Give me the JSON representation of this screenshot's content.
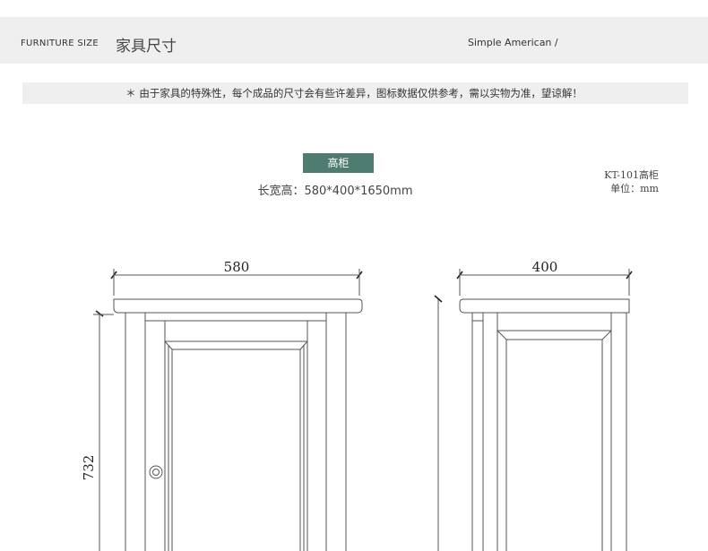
{
  "header": {
    "label_en": "FURNITURE SIZE",
    "label_zh": "家具尺寸",
    "style_label": "Simple American /"
  },
  "note": {
    "text": "＊ 由于家具的特殊性，每个成品的尺寸会有些许差异，图标数据仅供参考，需以实物为准，望谅解！"
  },
  "product": {
    "name": "高柜",
    "dimensions": "长宽高：580*400*1650mm",
    "model": "KT-101高柜",
    "unit": "单位：mm"
  },
  "drawing": {
    "front_width": "580",
    "side_width": "400",
    "height_label": "732"
  },
  "colors": {
    "accent": "#4e7c71",
    "band": "#efefef",
    "line": "#555555"
  }
}
